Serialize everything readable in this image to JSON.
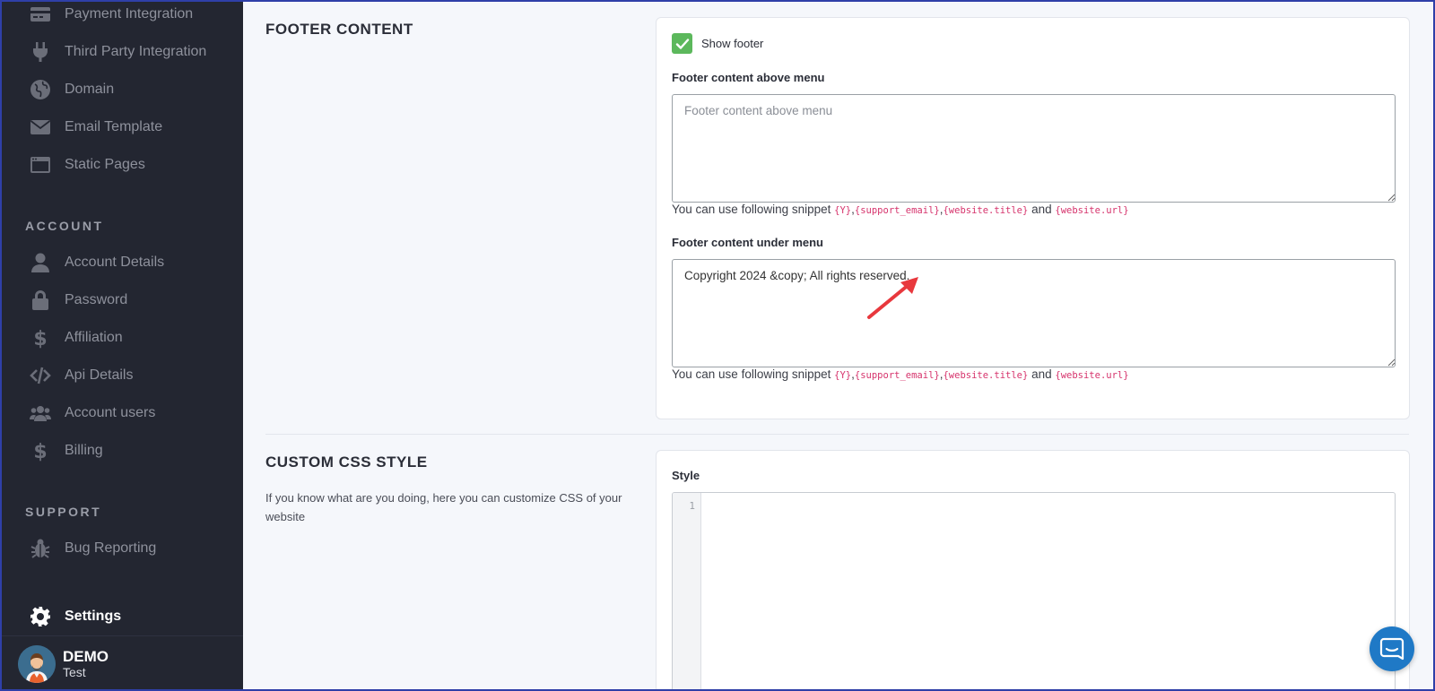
{
  "sidebar": {
    "items_top": [
      {
        "label": "Payment Integration",
        "icon": "credit-card-icon"
      },
      {
        "label": "Third Party Integration",
        "icon": "plug-icon"
      },
      {
        "label": "Domain",
        "icon": "globe-icon"
      },
      {
        "label": "Email Template",
        "icon": "envelope-icon"
      },
      {
        "label": "Static Pages",
        "icon": "window-icon"
      }
    ],
    "account_title": "ACCOUNT",
    "account_items": [
      {
        "label": "Account Details",
        "icon": "user-icon"
      },
      {
        "label": "Password",
        "icon": "lock-icon"
      },
      {
        "label": "Affiliation",
        "icon": "dollar-icon"
      },
      {
        "label": "Api Details",
        "icon": "code-icon"
      },
      {
        "label": "Account users",
        "icon": "users-icon"
      },
      {
        "label": "Billing",
        "icon": "dollar-icon"
      }
    ],
    "support_title": "SUPPORT",
    "support_items": [
      {
        "label": "Bug Reporting",
        "icon": "bug-icon"
      }
    ],
    "settings_label": "Settings",
    "user": {
      "name": "DEMO",
      "subtitle": "Test"
    }
  },
  "footer_section": {
    "heading": "FOOTER CONTENT",
    "show_footer_label": "Show footer",
    "show_footer_checked": true,
    "above_menu": {
      "label": "Footer content above menu",
      "placeholder": "Footer content above menu",
      "value": ""
    },
    "under_menu": {
      "label": "Footer content under menu",
      "value": "Copyright 2024 &copy; All rights reserved."
    },
    "hint": {
      "prefix": "You can use following snippet",
      "snippet_y": "{Y}",
      "sep1": ",",
      "snippet_email": "{support_email}",
      "sep2": ",",
      "snippet_title": "{website.title}",
      "and": "and",
      "snippet_url": "{website.url}"
    }
  },
  "css_section": {
    "heading": "CUSTOM CSS STYLE",
    "description": "If you know what are you doing, here you can customize CSS of your website",
    "style_label": "Style",
    "line_number": "1"
  },
  "colors": {
    "sidebar_bg": "#232631",
    "checkbox_green": "#5cb85c",
    "snippet_pink": "#d6336c",
    "chat_blue": "#1f79c6",
    "annotation_red": "#e8383d"
  }
}
